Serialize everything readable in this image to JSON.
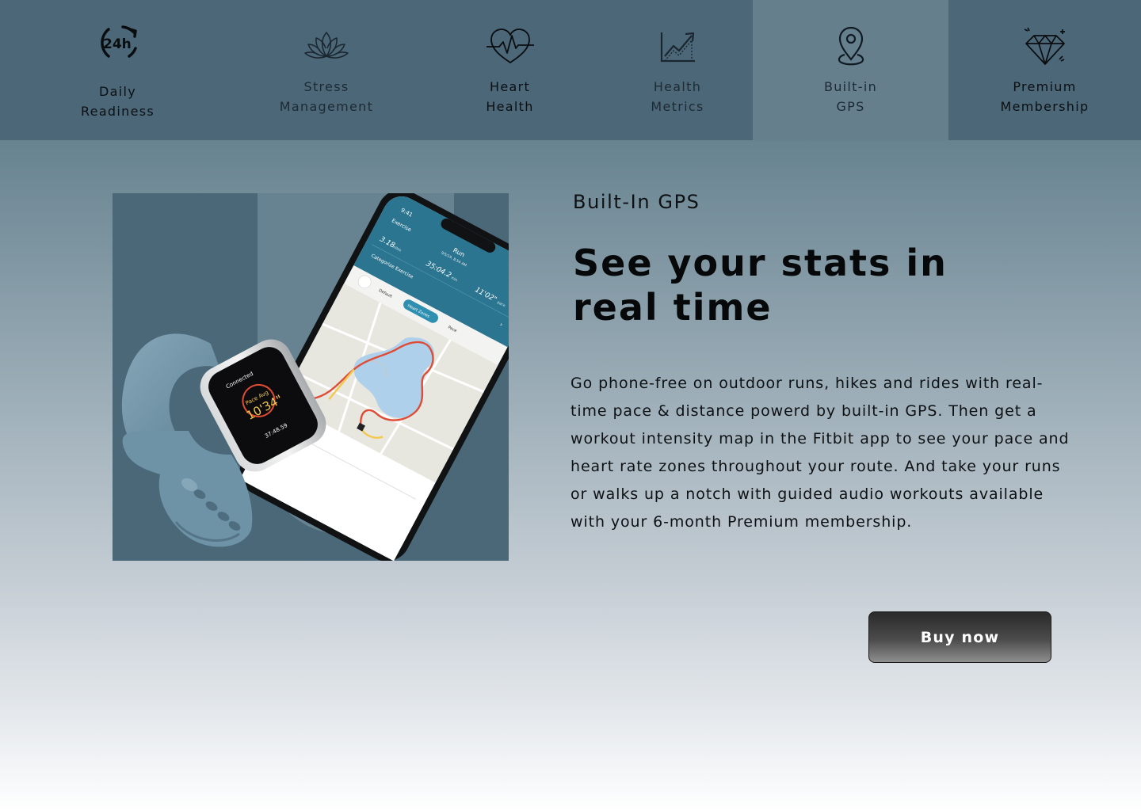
{
  "tabs": [
    {
      "label": "Daily\nReadiness",
      "icon": "24h-icon",
      "active": false
    },
    {
      "label": "Stress\nManagement",
      "icon": "lotus-icon",
      "active": false
    },
    {
      "label": "Heart\nHealth",
      "icon": "heart-pulse-icon",
      "active": false
    },
    {
      "label": "Health\nMetrics",
      "icon": "trend-chart-icon",
      "active": false
    },
    {
      "label": "Built-in\nGPS",
      "icon": "location-pin-icon",
      "active": true
    },
    {
      "label": "Premium\nMembership",
      "icon": "diamond-icon",
      "active": false
    }
  ],
  "content": {
    "section_label": "Built-In GPS",
    "headline": "See your stats in real time",
    "body": "Go phone-free on outdoor runs, hikes and rides with real-time pace & distance powerd by built-in GPS. Then get a workout intensity map in the Fitbit app to see your pace and heart rate zones throughout your route. And take your runs or walks up a notch with guided audio workouts available with your 6-month Premium membership.",
    "button_label": "Buy now"
  },
  "phone_screen": {
    "time": "9:41",
    "back_label": "Exercise",
    "title": "Run",
    "date": "9/5/19, 8:54 AM",
    "distance": "3.18",
    "distance_unit": "miles",
    "duration": "35:04.2",
    "duration_unit": "min",
    "pace": "11'02\"",
    "pace_unit": "pace",
    "categorize_label": "Categorize Exercise",
    "segments": [
      "Default",
      "Heart Zones",
      "Pace"
    ]
  },
  "watch_screen": {
    "status": "Connected",
    "metric_label": "Pace Avg",
    "metric_value": "10'34\"",
    "elapsed": "37:48.59"
  },
  "colors": {
    "tab_bg": "#4c6878",
    "tab_active_bg": "#657f8d",
    "image_bg": "#4b6878",
    "band": "#6f93a6",
    "app_header": "#2b7590",
    "heart_zone_pill": "#2f8fb0"
  }
}
